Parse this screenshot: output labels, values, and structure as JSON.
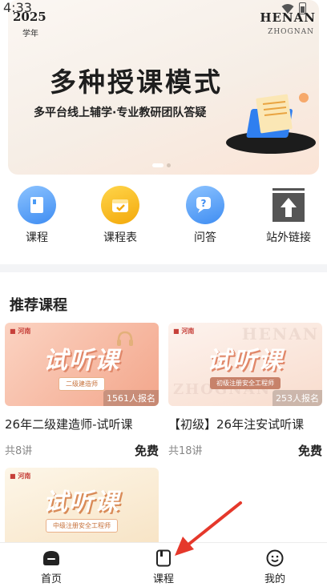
{
  "status_bar": {
    "time": "4:33"
  },
  "banner": {
    "year": "2025",
    "year_sub": "学年",
    "brand": "HENAN",
    "brand_sub": "ZHOGNAN",
    "title": "多种授课模式",
    "subtitle": "多平台线上辅学·专业教研团队答疑"
  },
  "quick_nav": [
    {
      "label": "课程",
      "icon": "book-icon",
      "color": "#4a9af5"
    },
    {
      "label": "课程表",
      "icon": "calendar-icon",
      "color": "#f6b40e"
    },
    {
      "label": "问答",
      "icon": "question-chat-icon",
      "color": "#4a9af5"
    },
    {
      "label": "站外链接",
      "icon": "upload-arrow-icon",
      "color": "#555555"
    }
  ],
  "recommended": {
    "title": "推荐课程",
    "courses": [
      {
        "thumb_text": "试听课",
        "thumb_tag": "二级建造师",
        "enroll": "1561人报名",
        "title": "26年二级建造师-试听课",
        "lessons": "共8讲",
        "price": "免费"
      },
      {
        "thumb_text": "试听课",
        "thumb_tag": "初级注册安全工程师",
        "enroll": "253人报名",
        "title": "【初级】26年注安试听课",
        "lessons": "共18讲",
        "price": "免费"
      },
      {
        "thumb_text": "试听课",
        "thumb_tag": "中级注册安全工程师",
        "enroll": "",
        "title": "",
        "lessons": "",
        "price": ""
      }
    ]
  },
  "bottom_nav": [
    {
      "label": "首页",
      "icon": "home-icon"
    },
    {
      "label": "课程",
      "icon": "course-book-icon"
    },
    {
      "label": "我的",
      "icon": "smiley-icon"
    }
  ],
  "colors": {
    "accent_red": "#e5382b",
    "nav_dark": "#222222"
  }
}
